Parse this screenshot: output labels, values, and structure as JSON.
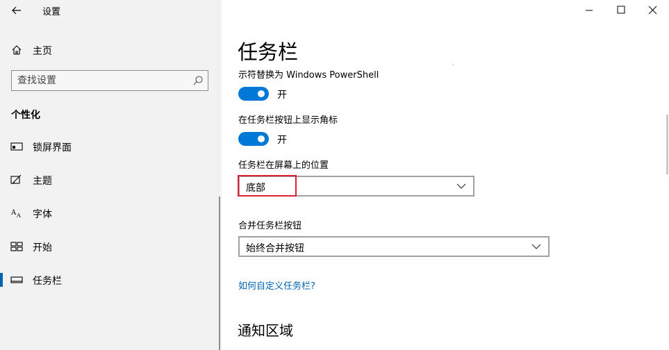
{
  "window": {
    "app_title": "设置"
  },
  "sidebar": {
    "home_label": "主页",
    "search_placeholder": "查找设置",
    "section_title": "个性化",
    "items": [
      {
        "label": "锁屏界面",
        "icon": "lock-screen-icon"
      },
      {
        "label": "主题",
        "icon": "theme-icon"
      },
      {
        "label": "字体",
        "icon": "font-icon"
      },
      {
        "label": "开始",
        "icon": "start-icon"
      },
      {
        "label": "任务栏",
        "icon": "taskbar-icon",
        "selected": true
      }
    ]
  },
  "main": {
    "title": "任务栏",
    "powershell_label": "示符替换为 Windows PowerShell",
    "powershell_state": "开",
    "badges_label": "在任务栏按钮上显示角标",
    "badges_state": "开",
    "position_label": "任务栏在屏幕上的位置",
    "position_value": "底部",
    "combine_label": "合并任务栏按钮",
    "combine_value": "始终合并按钮",
    "customize_link": "如何自定义任务栏?",
    "notification_heading": "通知区域"
  },
  "colors": {
    "accent": "#0078d7",
    "link": "#0063b1",
    "highlight": "#e02030",
    "sidebar_bg": "#f2f2f2"
  }
}
